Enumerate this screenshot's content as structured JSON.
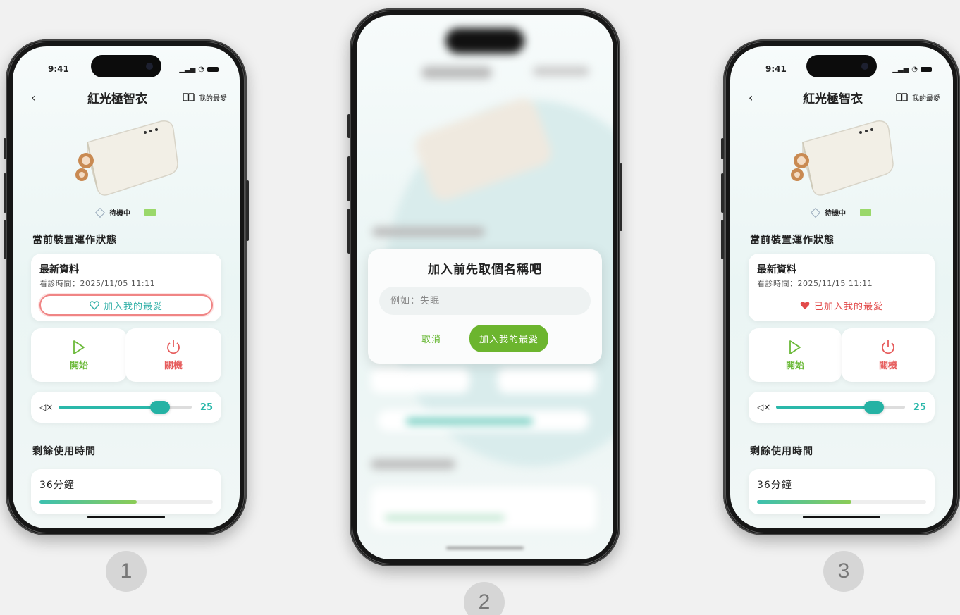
{
  "screens": {
    "s1": {
      "time": "9:41",
      "nav_title": "紅光極智衣",
      "fav_link": "我的最愛",
      "device_status": "待機中",
      "section_status": "當前裝置運作狀態",
      "info_title": "最新資料",
      "info_time": "看診時間：2025/11/05 11:11",
      "fav_button": "加入我的最愛",
      "start_label": "開始",
      "power_label": "關機",
      "volume": "25",
      "volume_level": 0.76,
      "section_remaining": "剩餘使用時間",
      "remaining": "36分鐘",
      "remaining_progress": 0.56
    },
    "s2": {
      "dialog_title": "加入前先取個名稱吧",
      "input_placeholder": "例如：失眠",
      "cancel": "取消",
      "confirm": "加入我的最愛"
    },
    "s3": {
      "time": "9:41",
      "nav_title": "紅光極智衣",
      "fav_link": "我的最愛",
      "device_status": "待機中",
      "section_status": "當前裝置運作狀態",
      "info_title": "最新資料",
      "info_time": "看診時間：2025/11/15 11:11",
      "fav_button": "已加入我的最愛",
      "start_label": "開始",
      "power_label": "關機",
      "volume": "25",
      "volume_level": 0.76,
      "section_remaining": "剩餘使用時間",
      "remaining": "36分鐘",
      "remaining_progress": 0.56
    }
  },
  "steps": [
    "1",
    "2",
    "3"
  ],
  "colors": {
    "accent_teal": "#2ab8aa",
    "start_green": "#6cba3a",
    "power_red": "#e65c5c",
    "favorite_red": "#e24a4a"
  },
  "icons": [
    "back-icon",
    "book-icon",
    "heart-outline-icon",
    "heart-filled-icon",
    "play-icon",
    "power-icon",
    "mute-icon"
  ]
}
